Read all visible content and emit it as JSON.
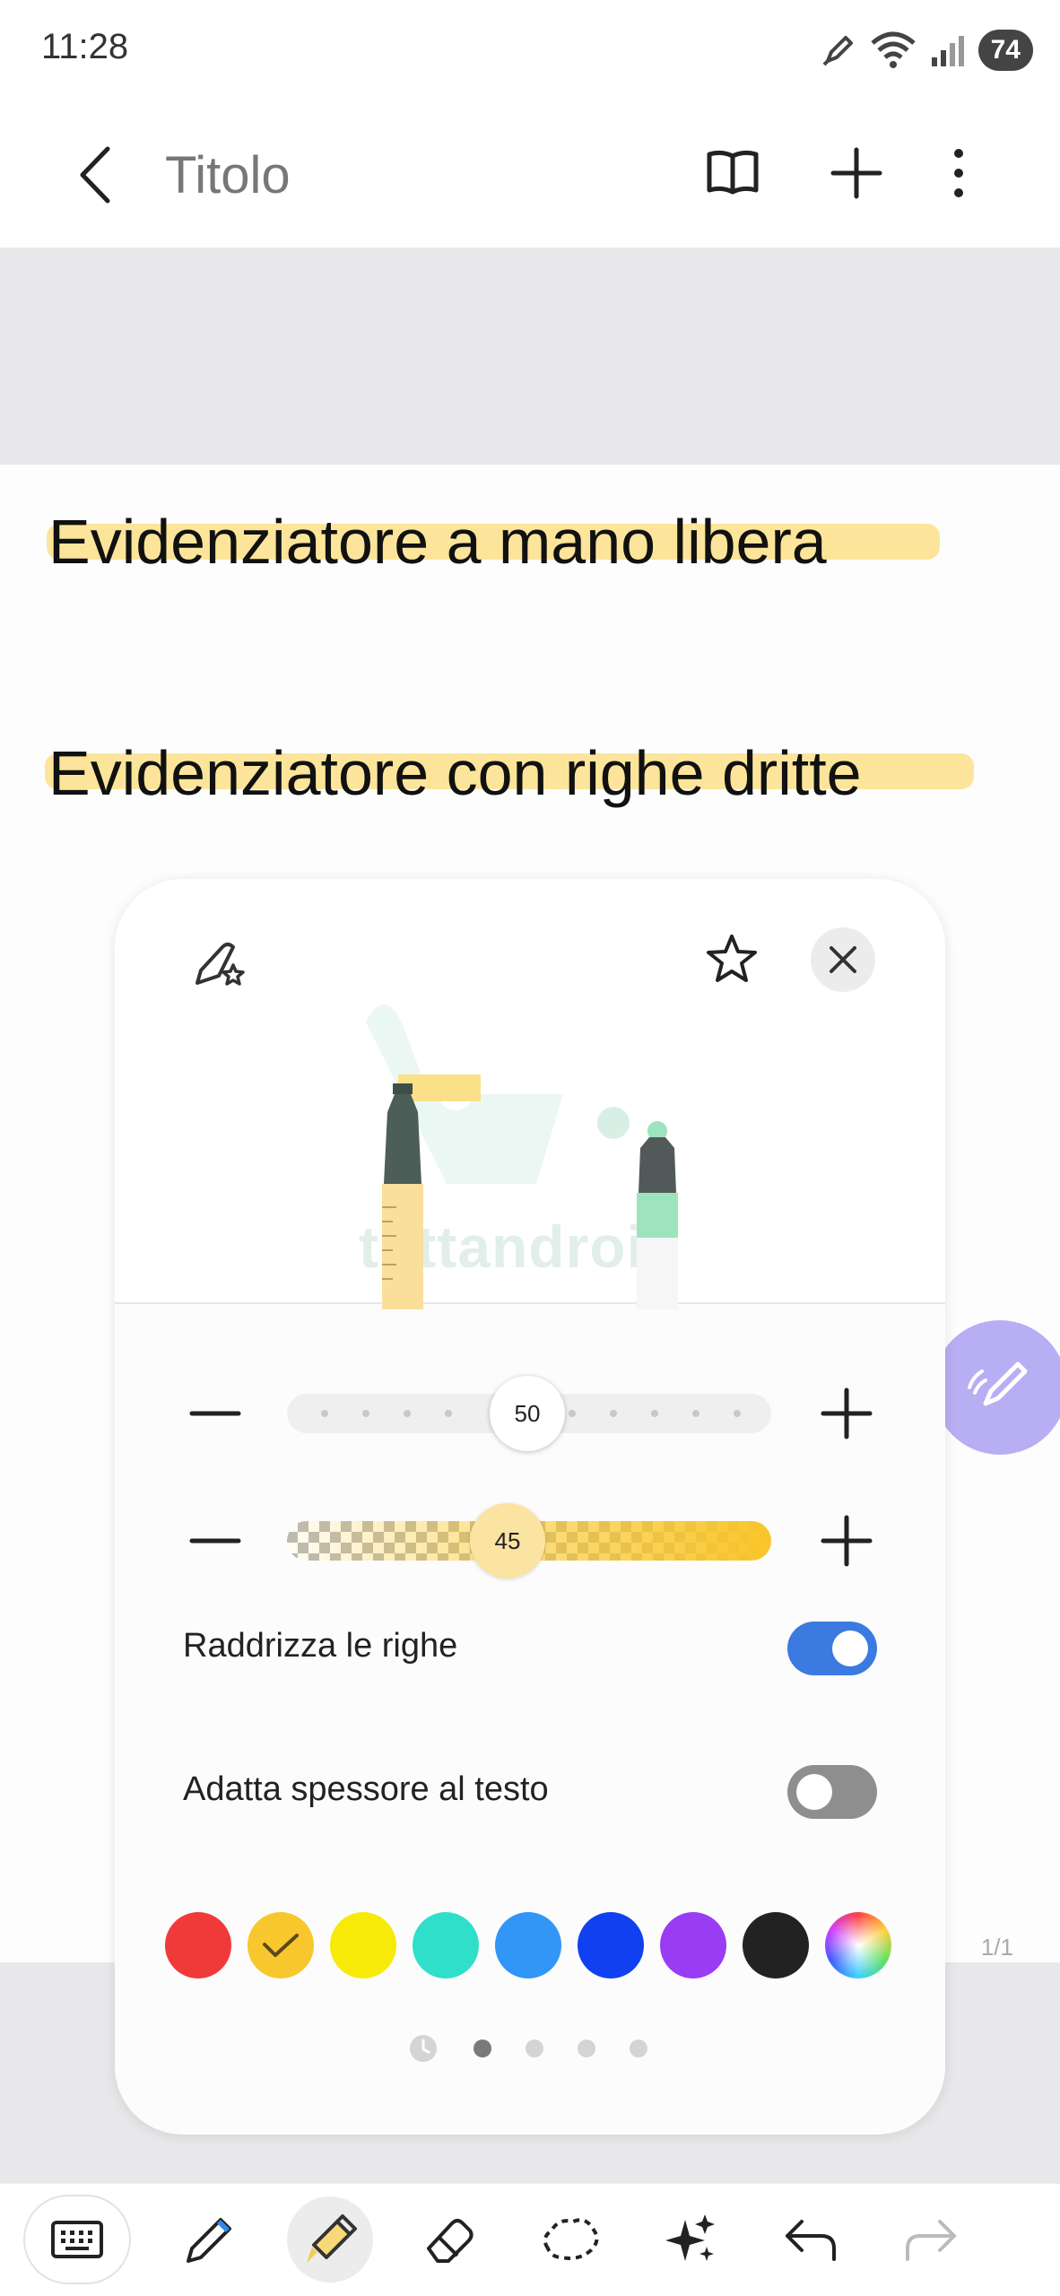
{
  "status_bar": {
    "time": "11:28",
    "battery": "74"
  },
  "app_bar": {
    "title": "Titolo"
  },
  "note": {
    "lines": [
      "Evidenziatore a mano libera",
      "Evidenziatore con righe dritte"
    ],
    "page_indicator": "1/1"
  },
  "panel": {
    "preview_watermark": "tuttandroid",
    "size_slider": {
      "value": "50"
    },
    "opacity_slider": {
      "value": "45"
    },
    "options": [
      {
        "label": "Raddrizza le righe",
        "enabled": true
      },
      {
        "label": "Adatta spessore al testo",
        "enabled": false
      }
    ],
    "colors": [
      {
        "name": "red",
        "hex": "#f03a3a",
        "selected": false
      },
      {
        "name": "amber",
        "hex": "#f8c72d",
        "selected": true
      },
      {
        "name": "yellow",
        "hex": "#f7ea07",
        "selected": false
      },
      {
        "name": "teal",
        "hex": "#2fdfc9",
        "selected": false
      },
      {
        "name": "sky-blue",
        "hex": "#3196f5",
        "selected": false
      },
      {
        "name": "blue",
        "hex": "#1140f0",
        "selected": false
      },
      {
        "name": "purple",
        "hex": "#9a3cf3",
        "selected": false
      },
      {
        "name": "black",
        "hex": "#222222",
        "selected": false
      },
      {
        "name": "color-wheel",
        "hex": "conic",
        "selected": false
      }
    ],
    "pager": {
      "pages": 4,
      "current": 1
    }
  },
  "toolbar": {
    "tools": [
      "keyboard-icon",
      "pen-icon",
      "highlighter-icon",
      "eraser-icon",
      "lasso-icon",
      "ai-sparkle-icon",
      "undo-icon",
      "redo-icon"
    ],
    "active": "highlighter-icon"
  }
}
